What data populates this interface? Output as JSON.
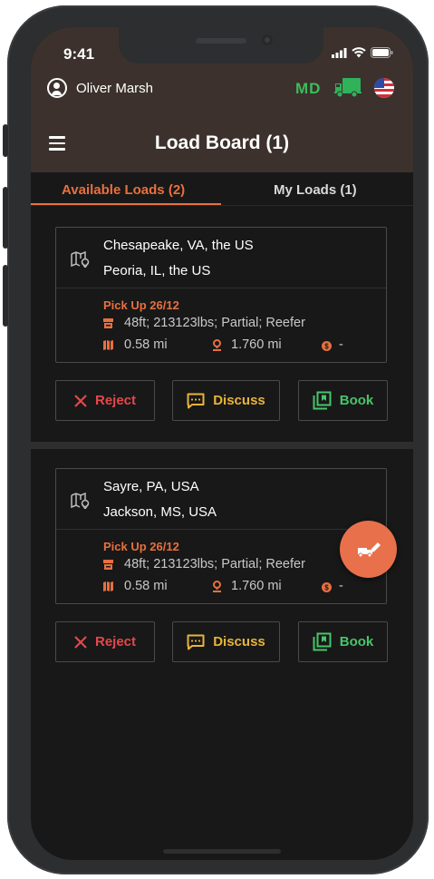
{
  "status_bar": {
    "time": "9:41"
  },
  "header": {
    "user_name": "Oliver Marsh",
    "state_code": "MD",
    "title": "Load Board (1)"
  },
  "tabs": [
    {
      "label": "Available Loads (2)",
      "active": true
    },
    {
      "label": "My Loads (1)",
      "active": false
    }
  ],
  "loads": [
    {
      "origin": "Chesapeake, VA, the US",
      "destination": "Peoria, IL, the US",
      "pickup": "Pick Up 26/12",
      "specs": "48ft; 213123lbs; Partial; Reefer",
      "deadhead": "0.58 mi",
      "distance": "1.760 mi",
      "rate": "-"
    },
    {
      "origin": "Sayre, PA, USA",
      "destination": "Jackson, MS, USA",
      "pickup": "Pick Up 26/12",
      "specs": "48ft; 213123lbs; Partial; Reefer",
      "deadhead": "0.58 mi",
      "distance": "1.760 mi",
      "rate": "-"
    }
  ],
  "actions": {
    "reject": "Reject",
    "discuss": "Discuss",
    "book": "Book"
  },
  "colors": {
    "accent": "#e8703f",
    "reject": "#e5474b",
    "discuss": "#e8b43a",
    "book": "#48c46a",
    "header_bg": "#3c312c"
  },
  "icons": [
    "user-circle-icon",
    "truck-icon",
    "us-flag-icon",
    "menu-icon",
    "map-route-icon",
    "trailer-icon",
    "deadhead-icon",
    "location-pin-icon",
    "rate-icon",
    "close-icon",
    "chat-icon",
    "book-icon",
    "quick-action-icon"
  ]
}
